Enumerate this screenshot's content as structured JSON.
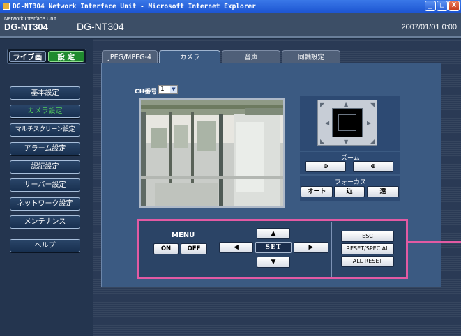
{
  "window": {
    "title": "DG-NT304 Network Interface Unit - Microsoft Internet Explorer",
    "buttons": [
      "_",
      "□",
      "X"
    ]
  },
  "header": {
    "unit_subtitle": "Network Interface Unit",
    "unit_name": "DG-NT304",
    "model": "DG-NT304",
    "datetime": "2007/01/01 0:00"
  },
  "mode": {
    "live": "ライブ画",
    "setup": "設 定"
  },
  "sidebar": {
    "items": [
      {
        "label": "基本設定",
        "active": false
      },
      {
        "label": "カメラ設定",
        "active": true
      },
      {
        "label": "マルチスクリーン設定",
        "active": false
      },
      {
        "label": "アラーム設定",
        "active": false
      },
      {
        "label": "認証設定",
        "active": false
      },
      {
        "label": "サーバー設定",
        "active": false
      },
      {
        "label": "ネットワーク設定",
        "active": false
      },
      {
        "label": "メンテナンス",
        "active": false
      },
      {
        "label": "ヘルプ",
        "active": false
      }
    ]
  },
  "tabs": [
    {
      "label": "JPEG/MPEG-4"
    },
    {
      "label": "カメラ"
    },
    {
      "label": "音声"
    },
    {
      "label": "同軸設定"
    }
  ],
  "camera": {
    "ch_label": "CH番号",
    "ch_value": "1"
  },
  "ptz": {
    "zoom_label": "ズーム",
    "zoom_out": "⊖",
    "zoom_in": "⊕",
    "focus_label": "フォーカス",
    "focus_auto": "オート",
    "focus_near": "近",
    "focus_far": "遠"
  },
  "menu_control": {
    "menu_label": "MENU",
    "on": "ON",
    "off": "OFF",
    "set": "SET",
    "esc": "ESC",
    "reset_special": "RESET/SPECIAL",
    "all_reset": "ALL RESET"
  },
  "colors": {
    "highlight": "#e25aa3",
    "active_nav": "#53d05a",
    "setup_mode": "#1f8a2e"
  }
}
